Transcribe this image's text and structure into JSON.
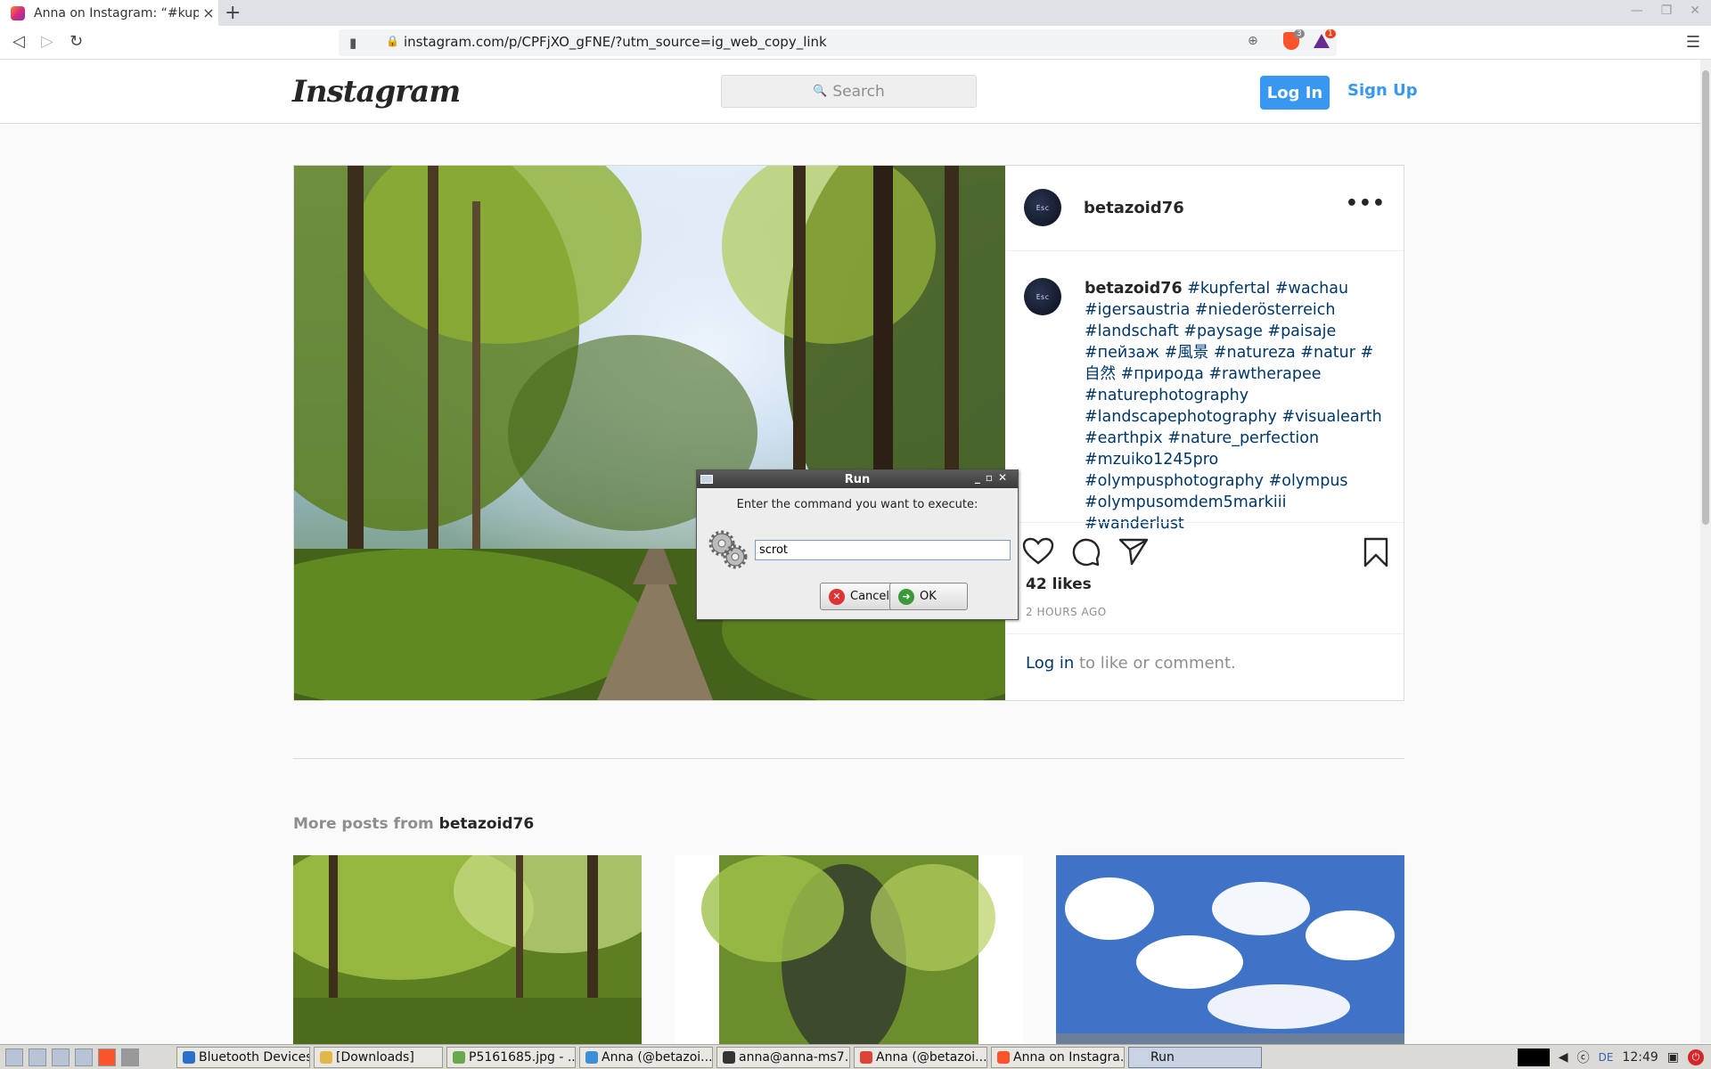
{
  "browser": {
    "tab_title": "Anna on Instagram: “#kupfe",
    "new_tab": "+",
    "close_tab": "×",
    "url": "instagram.com/p/CPFjXO_gFNE/?utm_source=ig_web_copy_link",
    "brave_shield_count": "3",
    "rewards_count": "1"
  },
  "instagram": {
    "logo": "Instagram",
    "search_placeholder": "Search",
    "login_button": "Log In",
    "signup_link": "Sign Up",
    "post": {
      "username": "betazoid76",
      "avatar_text": "Esc",
      "caption_user": "betazoid76",
      "caption_tags": "#kupfertal #wachau #igersaustria #niederösterreich #landschaft #paysage #paisaje #пейзаж #風景 #natureza #natur #自然 #природа #rawtherapee #naturephotography #landscapephotography #visualearth #earthpix #nature_perfection #mzuiko1245pro #olympusphotography #olympus #olympusomdem5markiii #wanderlust",
      "likes": "42 likes",
      "time": "2 HOURS AGO",
      "login_link": "Log in",
      "login_suffix": " to like or comment."
    },
    "more_posts_label": "More posts from ",
    "more_posts_user": "betazoid76"
  },
  "run_dialog": {
    "title": "Run",
    "prompt": "Enter the command you want to execute:",
    "command_value": "scrot",
    "cancel_label": "Cancel",
    "ok_label": "OK"
  },
  "taskbar": {
    "items": [
      "Bluetooth Devices",
      "[Downloads]",
      "P5161685.jpg - ...",
      "Anna (@betazoi...",
      "anna@anna-ms7...",
      "Anna (@betazoi...",
      "Anna on Instagra...",
      "Run"
    ],
    "keyboard_layout": "DE",
    "clock": "12:49"
  }
}
